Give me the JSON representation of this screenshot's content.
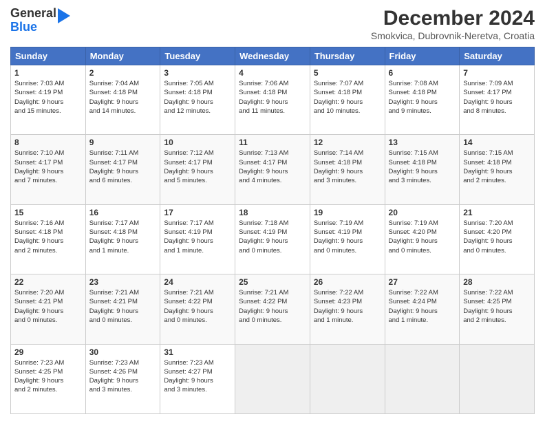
{
  "logo": {
    "line1": "General",
    "line2": "Blue"
  },
  "title": "December 2024",
  "subtitle": "Smokvica, Dubrovnik-Neretva, Croatia",
  "headers": [
    "Sunday",
    "Monday",
    "Tuesday",
    "Wednesday",
    "Thursday",
    "Friday",
    "Saturday"
  ],
  "weeks": [
    [
      {
        "day": "1",
        "info": "Sunrise: 7:03 AM\nSunset: 4:19 PM\nDaylight: 9 hours\nand 15 minutes."
      },
      {
        "day": "2",
        "info": "Sunrise: 7:04 AM\nSunset: 4:18 PM\nDaylight: 9 hours\nand 14 minutes."
      },
      {
        "day": "3",
        "info": "Sunrise: 7:05 AM\nSunset: 4:18 PM\nDaylight: 9 hours\nand 12 minutes."
      },
      {
        "day": "4",
        "info": "Sunrise: 7:06 AM\nSunset: 4:18 PM\nDaylight: 9 hours\nand 11 minutes."
      },
      {
        "day": "5",
        "info": "Sunrise: 7:07 AM\nSunset: 4:18 PM\nDaylight: 9 hours\nand 10 minutes."
      },
      {
        "day": "6",
        "info": "Sunrise: 7:08 AM\nSunset: 4:18 PM\nDaylight: 9 hours\nand 9 minutes."
      },
      {
        "day": "7",
        "info": "Sunrise: 7:09 AM\nSunset: 4:17 PM\nDaylight: 9 hours\nand 8 minutes."
      }
    ],
    [
      {
        "day": "8",
        "info": "Sunrise: 7:10 AM\nSunset: 4:17 PM\nDaylight: 9 hours\nand 7 minutes."
      },
      {
        "day": "9",
        "info": "Sunrise: 7:11 AM\nSunset: 4:17 PM\nDaylight: 9 hours\nand 6 minutes."
      },
      {
        "day": "10",
        "info": "Sunrise: 7:12 AM\nSunset: 4:17 PM\nDaylight: 9 hours\nand 5 minutes."
      },
      {
        "day": "11",
        "info": "Sunrise: 7:13 AM\nSunset: 4:17 PM\nDaylight: 9 hours\nand 4 minutes."
      },
      {
        "day": "12",
        "info": "Sunrise: 7:14 AM\nSunset: 4:18 PM\nDaylight: 9 hours\nand 3 minutes."
      },
      {
        "day": "13",
        "info": "Sunrise: 7:15 AM\nSunset: 4:18 PM\nDaylight: 9 hours\nand 3 minutes."
      },
      {
        "day": "14",
        "info": "Sunrise: 7:15 AM\nSunset: 4:18 PM\nDaylight: 9 hours\nand 2 minutes."
      }
    ],
    [
      {
        "day": "15",
        "info": "Sunrise: 7:16 AM\nSunset: 4:18 PM\nDaylight: 9 hours\nand 2 minutes."
      },
      {
        "day": "16",
        "info": "Sunrise: 7:17 AM\nSunset: 4:18 PM\nDaylight: 9 hours\nand 1 minute."
      },
      {
        "day": "17",
        "info": "Sunrise: 7:17 AM\nSunset: 4:19 PM\nDaylight: 9 hours\nand 1 minute."
      },
      {
        "day": "18",
        "info": "Sunrise: 7:18 AM\nSunset: 4:19 PM\nDaylight: 9 hours\nand 0 minutes."
      },
      {
        "day": "19",
        "info": "Sunrise: 7:19 AM\nSunset: 4:19 PM\nDaylight: 9 hours\nand 0 minutes."
      },
      {
        "day": "20",
        "info": "Sunrise: 7:19 AM\nSunset: 4:20 PM\nDaylight: 9 hours\nand 0 minutes."
      },
      {
        "day": "21",
        "info": "Sunrise: 7:20 AM\nSunset: 4:20 PM\nDaylight: 9 hours\nand 0 minutes."
      }
    ],
    [
      {
        "day": "22",
        "info": "Sunrise: 7:20 AM\nSunset: 4:21 PM\nDaylight: 9 hours\nand 0 minutes."
      },
      {
        "day": "23",
        "info": "Sunrise: 7:21 AM\nSunset: 4:21 PM\nDaylight: 9 hours\nand 0 minutes."
      },
      {
        "day": "24",
        "info": "Sunrise: 7:21 AM\nSunset: 4:22 PM\nDaylight: 9 hours\nand 0 minutes."
      },
      {
        "day": "25",
        "info": "Sunrise: 7:21 AM\nSunset: 4:22 PM\nDaylight: 9 hours\nand 0 minutes."
      },
      {
        "day": "26",
        "info": "Sunrise: 7:22 AM\nSunset: 4:23 PM\nDaylight: 9 hours\nand 1 minute."
      },
      {
        "day": "27",
        "info": "Sunrise: 7:22 AM\nSunset: 4:24 PM\nDaylight: 9 hours\nand 1 minute."
      },
      {
        "day": "28",
        "info": "Sunrise: 7:22 AM\nSunset: 4:25 PM\nDaylight: 9 hours\nand 2 minutes."
      }
    ],
    [
      {
        "day": "29",
        "info": "Sunrise: 7:23 AM\nSunset: 4:25 PM\nDaylight: 9 hours\nand 2 minutes."
      },
      {
        "day": "30",
        "info": "Sunrise: 7:23 AM\nSunset: 4:26 PM\nDaylight: 9 hours\nand 3 minutes."
      },
      {
        "day": "31",
        "info": "Sunrise: 7:23 AM\nSunset: 4:27 PM\nDaylight: 9 hours\nand 3 minutes."
      },
      null,
      null,
      null,
      null
    ]
  ]
}
